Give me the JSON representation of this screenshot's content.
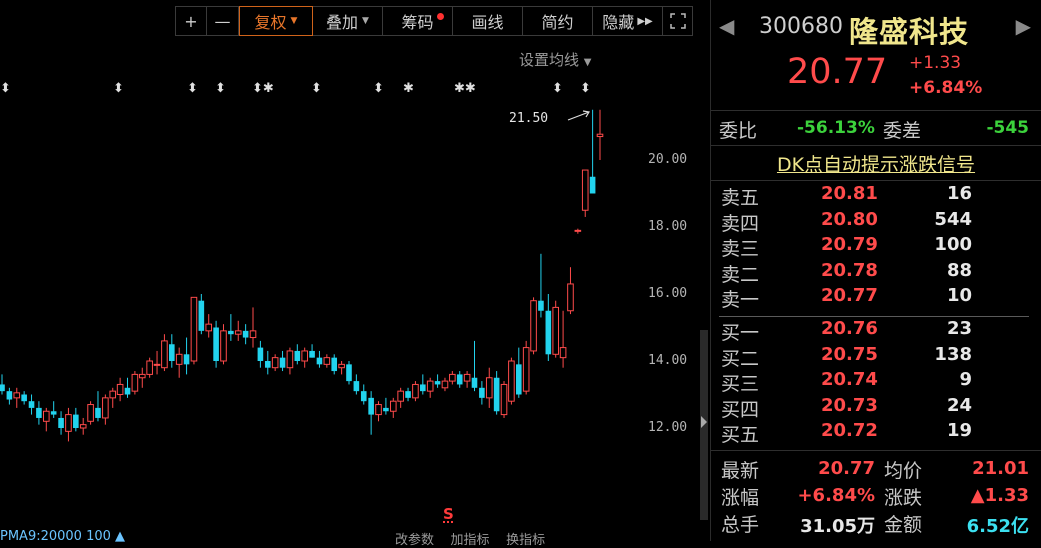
{
  "toolbar": {
    "plus": "+",
    "minus": "—",
    "fuquan": "复权",
    "diejia": "叠加",
    "chouma": "筹码",
    "huaxian": "画线",
    "jianyue": "简约",
    "yincang": "隐藏",
    "expand_icon": "expand-icon"
  },
  "chart": {
    "ma_setting": "设置均线",
    "high_annotation": "21.50",
    "s_marker": "S",
    "bottom_left": "PMA9:20000 100 ▲",
    "bottom_buttons": [
      "改参数",
      "加指标",
      "换指标"
    ]
  },
  "chart_data": {
    "type": "candlestick",
    "y_ticks": [
      "20.00",
      "18.00",
      "16.00",
      "14.00",
      "12.00"
    ],
    "ylim": [
      11.5,
      21.8
    ],
    "candles": [
      {
        "o": 13.3,
        "h": 13.6,
        "l": 13.0,
        "c": 13.1
      },
      {
        "o": 13.1,
        "h": 13.2,
        "l": 12.7,
        "c": 12.85
      },
      {
        "o": 12.9,
        "h": 13.2,
        "l": 12.6,
        "c": 13.05
      },
      {
        "o": 13.0,
        "h": 13.1,
        "l": 12.7,
        "c": 12.8
      },
      {
        "o": 12.8,
        "h": 13.0,
        "l": 12.4,
        "c": 12.6
      },
      {
        "o": 12.6,
        "h": 12.8,
        "l": 12.1,
        "c": 12.3
      },
      {
        "o": 12.2,
        "h": 12.6,
        "l": 11.9,
        "c": 12.5
      },
      {
        "o": 12.5,
        "h": 12.8,
        "l": 12.3,
        "c": 12.4
      },
      {
        "o": 12.3,
        "h": 12.5,
        "l": 11.8,
        "c": 12.0
      },
      {
        "o": 11.9,
        "h": 12.6,
        "l": 11.6,
        "c": 12.4
      },
      {
        "o": 12.4,
        "h": 12.6,
        "l": 11.9,
        "c": 12.0
      },
      {
        "o": 12.0,
        "h": 12.3,
        "l": 11.8,
        "c": 12.1
      },
      {
        "o": 12.2,
        "h": 12.8,
        "l": 12.1,
        "c": 12.7
      },
      {
        "o": 12.6,
        "h": 13.1,
        "l": 12.2,
        "c": 12.3
      },
      {
        "o": 12.3,
        "h": 13.0,
        "l": 12.1,
        "c": 12.9
      },
      {
        "o": 12.9,
        "h": 13.2,
        "l": 12.6,
        "c": 13.1
      },
      {
        "o": 13.0,
        "h": 13.5,
        "l": 12.8,
        "c": 13.3
      },
      {
        "o": 13.2,
        "h": 13.5,
        "l": 12.9,
        "c": 13.0
      },
      {
        "o": 13.1,
        "h": 13.7,
        "l": 13.0,
        "c": 13.6
      },
      {
        "o": 13.5,
        "h": 13.8,
        "l": 13.2,
        "c": 13.6
      },
      {
        "o": 13.6,
        "h": 14.1,
        "l": 13.5,
        "c": 14.0
      },
      {
        "o": 13.9,
        "h": 14.3,
        "l": 13.6,
        "c": 13.9
      },
      {
        "o": 13.8,
        "h": 14.8,
        "l": 13.7,
        "c": 14.6
      },
      {
        "o": 14.5,
        "h": 14.8,
        "l": 13.8,
        "c": 14.0
      },
      {
        "o": 13.9,
        "h": 14.4,
        "l": 13.5,
        "c": 14.2
      },
      {
        "o": 14.2,
        "h": 14.7,
        "l": 13.6,
        "c": 13.9
      },
      {
        "o": 14.0,
        "h": 15.9,
        "l": 13.9,
        "c": 15.9
      },
      {
        "o": 15.8,
        "h": 16.0,
        "l": 14.8,
        "c": 14.9
      },
      {
        "o": 14.9,
        "h": 15.4,
        "l": 14.7,
        "c": 15.1
      },
      {
        "o": 15.0,
        "h": 15.2,
        "l": 13.8,
        "c": 14.0
      },
      {
        "o": 14.0,
        "h": 15.1,
        "l": 13.9,
        "c": 14.9
      },
      {
        "o": 14.9,
        "h": 15.4,
        "l": 14.6,
        "c": 14.8
      },
      {
        "o": 14.8,
        "h": 15.2,
        "l": 14.6,
        "c": 14.9
      },
      {
        "o": 14.9,
        "h": 15.1,
        "l": 14.5,
        "c": 14.7
      },
      {
        "o": 14.7,
        "h": 15.6,
        "l": 14.4,
        "c": 14.9
      },
      {
        "o": 14.4,
        "h": 14.6,
        "l": 13.8,
        "c": 14.0
      },
      {
        "o": 14.0,
        "h": 14.3,
        "l": 13.6,
        "c": 13.8
      },
      {
        "o": 13.8,
        "h": 14.2,
        "l": 13.7,
        "c": 14.1
      },
      {
        "o": 14.1,
        "h": 14.3,
        "l": 13.7,
        "c": 13.8
      },
      {
        "o": 13.8,
        "h": 14.4,
        "l": 13.6,
        "c": 14.3
      },
      {
        "o": 14.3,
        "h": 14.5,
        "l": 13.9,
        "c": 14.0
      },
      {
        "o": 14.0,
        "h": 14.4,
        "l": 13.8,
        "c": 14.3
      },
      {
        "o": 14.3,
        "h": 14.5,
        "l": 14.1,
        "c": 14.1
      },
      {
        "o": 14.1,
        "h": 14.3,
        "l": 13.8,
        "c": 13.9
      },
      {
        "o": 13.9,
        "h": 14.2,
        "l": 13.8,
        "c": 14.1
      },
      {
        "o": 14.1,
        "h": 14.2,
        "l": 13.6,
        "c": 13.7
      },
      {
        "o": 13.8,
        "h": 14.0,
        "l": 13.6,
        "c": 13.9
      },
      {
        "o": 13.9,
        "h": 14.0,
        "l": 13.3,
        "c": 13.4
      },
      {
        "o": 13.4,
        "h": 13.6,
        "l": 13.0,
        "c": 13.1
      },
      {
        "o": 13.1,
        "h": 13.3,
        "l": 12.7,
        "c": 12.8
      },
      {
        "o": 12.9,
        "h": 13.1,
        "l": 11.8,
        "c": 12.4
      },
      {
        "o": 12.4,
        "h": 12.8,
        "l": 12.2,
        "c": 12.7
      },
      {
        "o": 12.6,
        "h": 12.9,
        "l": 12.4,
        "c": 12.5
      },
      {
        "o": 12.5,
        "h": 12.9,
        "l": 12.3,
        "c": 12.8
      },
      {
        "o": 12.8,
        "h": 13.2,
        "l": 12.6,
        "c": 13.1
      },
      {
        "o": 13.1,
        "h": 13.2,
        "l": 12.8,
        "c": 12.9
      },
      {
        "o": 12.9,
        "h": 13.4,
        "l": 12.8,
        "c": 13.3
      },
      {
        "o": 13.3,
        "h": 13.6,
        "l": 13.0,
        "c": 13.1
      },
      {
        "o": 13.1,
        "h": 13.5,
        "l": 12.9,
        "c": 13.4
      },
      {
        "o": 13.4,
        "h": 13.6,
        "l": 13.2,
        "c": 13.3
      },
      {
        "o": 13.2,
        "h": 13.5,
        "l": 13.1,
        "c": 13.4
      },
      {
        "o": 13.4,
        "h": 13.7,
        "l": 13.3,
        "c": 13.6
      },
      {
        "o": 13.6,
        "h": 13.7,
        "l": 13.2,
        "c": 13.3
      },
      {
        "o": 13.4,
        "h": 13.7,
        "l": 13.2,
        "c": 13.6
      },
      {
        "o": 13.5,
        "h": 14.6,
        "l": 13.1,
        "c": 13.2
      },
      {
        "o": 13.2,
        "h": 13.4,
        "l": 12.7,
        "c": 12.9
      },
      {
        "o": 12.9,
        "h": 13.8,
        "l": 12.6,
        "c": 13.5
      },
      {
        "o": 13.5,
        "h": 13.7,
        "l": 12.4,
        "c": 12.5
      },
      {
        "o": 12.4,
        "h": 13.4,
        "l": 12.3,
        "c": 13.3
      },
      {
        "o": 12.8,
        "h": 14.1,
        "l": 12.7,
        "c": 14.0
      },
      {
        "o": 13.9,
        "h": 14.4,
        "l": 12.9,
        "c": 13.0
      },
      {
        "o": 13.1,
        "h": 14.6,
        "l": 13.0,
        "c": 14.4
      },
      {
        "o": 14.3,
        "h": 15.9,
        "l": 14.2,
        "c": 15.8
      },
      {
        "o": 15.8,
        "h": 17.2,
        "l": 15.3,
        "c": 15.5
      },
      {
        "o": 15.5,
        "h": 16.0,
        "l": 14.0,
        "c": 14.2
      },
      {
        "o": 14.2,
        "h": 15.8,
        "l": 14.1,
        "c": 15.6
      },
      {
        "o": 14.1,
        "h": 15.5,
        "l": 13.8,
        "c": 14.4
      },
      {
        "o": 15.5,
        "h": 16.8,
        "l": 15.4,
        "c": 16.3
      },
      {
        "o": 17.9,
        "h": 17.95,
        "l": 17.8,
        "c": 17.9
      },
      {
        "o": 18.5,
        "h": 19.7,
        "l": 18.3,
        "c": 19.7
      },
      {
        "o": 19.5,
        "h": 21.5,
        "l": 19.2,
        "c": 19.0
      },
      {
        "o": 20.7,
        "h": 21.5,
        "l": 20.0,
        "c": 20.77
      }
    ],
    "markers_row": [
      "⬍",
      "⬍",
      "⬍",
      "⬍",
      "⬍✱",
      "⬍",
      "⬍",
      "✱",
      "✱✱",
      "⬍",
      "⬍"
    ]
  },
  "quote": {
    "code": "300680",
    "name": "隆盛科技",
    "price": "20.77",
    "change": "+1.33",
    "change_pct": "+6.84%",
    "weibi_label": "委比",
    "weibi": "-56.13%",
    "weicha_label": "委差",
    "weicha": "-545",
    "dk_link": "DK点自动提示涨跌信号",
    "asks": [
      {
        "label": "卖五",
        "price": "20.81",
        "vol": "16"
      },
      {
        "label": "卖四",
        "price": "20.80",
        "vol": "544"
      },
      {
        "label": "卖三",
        "price": "20.79",
        "vol": "100"
      },
      {
        "label": "卖二",
        "price": "20.78",
        "vol": "88"
      },
      {
        "label": "卖一",
        "price": "20.77",
        "vol": "10"
      }
    ],
    "bids": [
      {
        "label": "买一",
        "price": "20.76",
        "vol": "23"
      },
      {
        "label": "买二",
        "price": "20.75",
        "vol": "138"
      },
      {
        "label": "买三",
        "price": "20.74",
        "vol": "9"
      },
      {
        "label": "买四",
        "price": "20.73",
        "vol": "24"
      },
      {
        "label": "买五",
        "price": "20.72",
        "vol": "19"
      }
    ],
    "stats": {
      "latest_label": "最新",
      "latest": "20.77",
      "avg_label": "均价",
      "avg": "21.01",
      "zf_label": "涨幅",
      "zf": "+6.84%",
      "zd_label": "涨跌",
      "zd": "▲1.33",
      "vol_label": "总手",
      "vol": "31.05万",
      "amt_label": "金额",
      "amt": "6.52亿"
    }
  },
  "colors": {
    "up": "#ff4b4b",
    "down": "#22d3ee",
    "yellow": "#f0e68c",
    "green": "#3cd23c"
  }
}
